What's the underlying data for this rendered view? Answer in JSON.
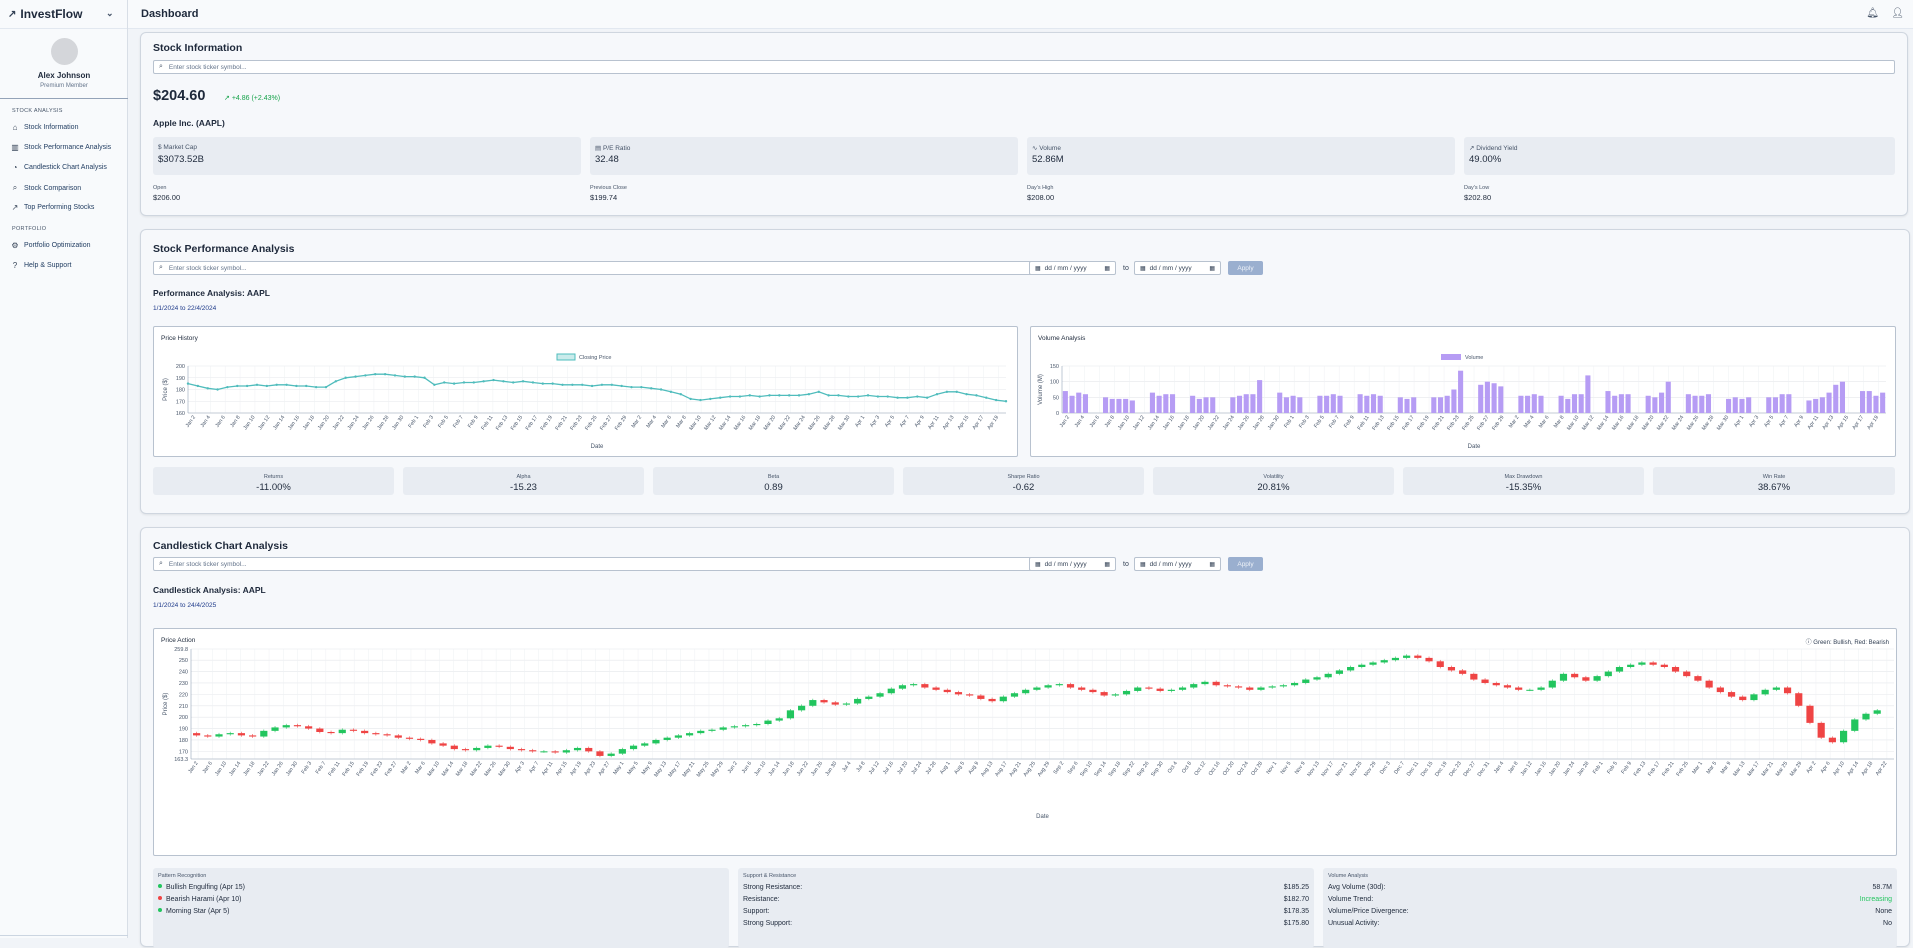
{
  "app": {
    "name": "InvestFlow",
    "page_title": "Dashboard"
  },
  "user": {
    "name": "Alex Johnson",
    "role": "Premium Member"
  },
  "nav": {
    "section_stock": "STOCK ANALYSIS",
    "section_portfolio": "PORTFOLIO",
    "items": [
      {
        "label": "Stock Information",
        "icon": "home-icon"
      },
      {
        "label": "Stock Performance Analysis",
        "icon": "bar-chart-icon"
      },
      {
        "label": "Candlestick Chart Analysis",
        "icon": "pie-chart-icon"
      },
      {
        "label": "Stock Comparison",
        "icon": "search-icon"
      },
      {
        "label": "Top Performing Stocks",
        "icon": "trending-up-icon"
      },
      {
        "label": "Portfolio Optimization",
        "icon": "gear-icon"
      },
      {
        "label": "Help & Support",
        "icon": "help-icon"
      }
    ]
  },
  "stock_info": {
    "title": "Stock Information",
    "search_placeholder": "Enter stock ticker symbol...",
    "price": "$204.60",
    "change": "+4.86 (+2.43%)",
    "company": "Apple Inc. (AAPL)",
    "metrics": [
      {
        "label": "Market Cap",
        "value": "$3073.52B",
        "icon": "dollar-icon"
      },
      {
        "label": "P/E Ratio",
        "value": "32.48",
        "icon": "calculator-icon"
      },
      {
        "label": "Volume",
        "value": "52.86M",
        "icon": "activity-icon"
      },
      {
        "label": "Dividend Yield",
        "value": "49.00%",
        "icon": "trending-up-icon"
      }
    ],
    "details": [
      {
        "label": "Open",
        "value": "$206.00"
      },
      {
        "label": "Previous Close",
        "value": "$199.74"
      },
      {
        "label": "Day's High",
        "value": "$208.00"
      },
      {
        "label": "Day's Low",
        "value": "$202.80"
      }
    ]
  },
  "performance": {
    "title": "Stock Performance Analysis",
    "search_placeholder": "Enter stock ticker symbol...",
    "date_placeholder": "dd / mm / yyyy",
    "to": "to",
    "apply": "Apply",
    "subtitle": "Performance Analysis: AAPL",
    "range": "1/1/2024 to 22/4/2024",
    "price_chart_title": "Price History",
    "volume_chart_title": "Volume Analysis",
    "stats": [
      {
        "label": "Returns",
        "value": "-11.00%"
      },
      {
        "label": "Alpha",
        "value": "-15.23"
      },
      {
        "label": "Beta",
        "value": "0.89"
      },
      {
        "label": "Sharpe Ratio",
        "value": "-0.62"
      },
      {
        "label": "Volatility",
        "value": "20.81%"
      },
      {
        "label": "Max Drawdown",
        "value": "-15.35%"
      },
      {
        "label": "Win Rate",
        "value": "38.67%"
      }
    ]
  },
  "candlestick": {
    "title": "Candlestick Chart Analysis",
    "search_placeholder": "Enter stock ticker symbol...",
    "date_placeholder": "dd / mm / yyyy",
    "to": "to",
    "apply": "Apply",
    "subtitle": "Candlestick Analysis: AAPL",
    "range": "1/1/2024 to 24/4/2025",
    "chart_title": "Price Action",
    "legend_note": "Green: Bullish, Red: Bearish",
    "patterns_header": "Pattern Recognition",
    "patterns": [
      {
        "label": "Bullish Engulfing (Apr 15)",
        "color": "#22c55e"
      },
      {
        "label": "Bearish Harami (Apr 10)",
        "color": "#ef4444"
      },
      {
        "label": "Morning Star (Apr 5)",
        "color": "#22c55e"
      }
    ],
    "sr_header": "Support & Resistance",
    "sr": [
      {
        "label": "Strong Resistance:",
        "value": "$185.25"
      },
      {
        "label": "Resistance:",
        "value": "$182.70"
      },
      {
        "label": "Support:",
        "value": "$178.35"
      },
      {
        "label": "Strong Support:",
        "value": "$175.80"
      }
    ],
    "vol_header": "Volume Analysis",
    "vol": [
      {
        "label": "Avg Volume (30d):",
        "value": "58.7M"
      },
      {
        "label": "Volume Trend:",
        "value": "Increasing",
        "color": "#22c55e"
      },
      {
        "label": "Volume/Price Divergence:",
        "value": "None"
      },
      {
        "label": "Unusual Activity:",
        "value": "No"
      }
    ]
  },
  "chart_data": [
    {
      "type": "line",
      "title": "Price History",
      "series_name": "Closing Price",
      "xlabel": "Date",
      "ylabel": "Price ($)",
      "ylim": [
        160,
        200
      ],
      "yticks": [
        160,
        170,
        180,
        190,
        200
      ],
      "x_ticks": [
        "Jan 2",
        "Jan 4",
        "Jan 6",
        "Jan 8",
        "Jan 10",
        "Jan 12",
        "Jan 14",
        "Jan 16",
        "Jan 18",
        "Jan 20",
        "Jan 22",
        "Jan 24",
        "Jan 26",
        "Jan 28",
        "Jan 30",
        "Feb 1",
        "Feb 3",
        "Feb 5",
        "Feb 7",
        "Feb 9",
        "Feb 11",
        "Feb 13",
        "Feb 15",
        "Feb 17",
        "Feb 19",
        "Feb 21",
        "Feb 23",
        "Feb 25",
        "Feb 27",
        "Feb 29",
        "Mar 2",
        "Mar 4",
        "Mar 6",
        "Mar 8",
        "Mar 10",
        "Mar 12",
        "Mar 14",
        "Mar 16",
        "Mar 18",
        "Mar 20",
        "Mar 22",
        "Mar 24",
        "Mar 26",
        "Mar 28",
        "Mar 30",
        "Apr 1",
        "Apr 3",
        "Apr 5",
        "Apr 7",
        "Apr 9",
        "Apr 11",
        "Apr 13",
        "Apr 15",
        "Apr 17",
        "Apr 19"
      ],
      "values": [
        185,
        183,
        181,
        180,
        182,
        183,
        183,
        184,
        183,
        184,
        184,
        183,
        183,
        182,
        182,
        187,
        190,
        191,
        192,
        193,
        193,
        192,
        191,
        191,
        190,
        184,
        186,
        185,
        186,
        186,
        187,
        188,
        187,
        186,
        187,
        186,
        185,
        185,
        184,
        184,
        184,
        183,
        184,
        184,
        183,
        182,
        182,
        181,
        180,
        178,
        176,
        172,
        171,
        172,
        173,
        174,
        174,
        175,
        174,
        175,
        175,
        175,
        175,
        176,
        178,
        175,
        175,
        174,
        174,
        175,
        174,
        174,
        173,
        173,
        174,
        173,
        176,
        178,
        178,
        176,
        175,
        173,
        171,
        170
      ]
    },
    {
      "type": "bar",
      "title": "Volume Analysis",
      "series_name": "Volume",
      "xlabel": "Date",
      "ylabel": "Volume (M)",
      "ylim": [
        0,
        150
      ],
      "yticks": [
        0,
        50,
        100,
        150
      ],
      "x_ticks": [
        "Jan 2",
        "Jan 4",
        "Jan 6",
        "Jan 8",
        "Jan 10",
        "Jan 12",
        "Jan 14",
        "Jan 16",
        "Jan 18",
        "Jan 20",
        "Jan 22",
        "Jan 24",
        "Jan 26",
        "Jan 28",
        "Jan 30",
        "Feb 1",
        "Feb 3",
        "Feb 5",
        "Feb 7",
        "Feb 9",
        "Feb 11",
        "Feb 13",
        "Feb 15",
        "Feb 17",
        "Feb 19",
        "Feb 21",
        "Feb 23",
        "Feb 25",
        "Feb 27",
        "Feb 29",
        "Mar 2",
        "Mar 4",
        "Mar 6",
        "Mar 8",
        "Mar 10",
        "Mar 12",
        "Mar 14",
        "Mar 16",
        "Mar 18",
        "Mar 20",
        "Mar 22",
        "Mar 24",
        "Mar 26",
        "Mar 28",
        "Mar 30",
        "Apr 1",
        "Apr 3",
        "Apr 5",
        "Apr 7",
        "Apr 9",
        "Apr 11",
        "Apr 13",
        "Apr 15",
        "Apr 17",
        "Apr 19"
      ],
      "values": [
        70,
        55,
        65,
        60,
        0,
        0,
        50,
        45,
        45,
        45,
        40,
        0,
        0,
        65,
        55,
        60,
        60,
        0,
        0,
        55,
        45,
        50,
        50,
        0,
        0,
        50,
        55,
        60,
        60,
        105,
        0,
        0,
        65,
        50,
        55,
        50,
        0,
        0,
        55,
        55,
        60,
        55,
        0,
        0,
        60,
        55,
        60,
        55,
        0,
        0,
        50,
        45,
        50,
        0,
        0,
        50,
        50,
        55,
        75,
        135,
        0,
        0,
        90,
        100,
        95,
        85,
        0,
        0,
        55,
        55,
        60,
        55,
        0,
        0,
        55,
        45,
        60,
        60,
        120,
        0,
        0,
        70,
        55,
        60,
        60,
        0,
        0,
        55,
        50,
        65,
        100,
        0,
        0,
        60,
        55,
        55,
        60,
        0,
        0,
        45,
        50,
        45,
        50,
        0,
        0,
        50,
        50,
        60,
        60,
        0,
        0,
        40,
        45,
        50,
        65,
        90,
        100,
        0,
        0,
        70,
        70,
        55,
        65
      ]
    },
    {
      "type": "candlestick",
      "title": "Price Action",
      "xlabel": "Date",
      "ylabel": "Price ($)",
      "ylim": [
        163.3,
        259.8
      ],
      "yticks": [
        163.3,
        170,
        180,
        190,
        200,
        210,
        220,
        230,
        240,
        250,
        259.8
      ],
      "x_ticks": [
        "Jan 2",
        "Jan 6",
        "Jan 10",
        "Jan 14",
        "Jan 18",
        "Jan 22",
        "Jan 26",
        "Jan 30",
        "Feb 3",
        "Feb 7",
        "Feb 11",
        "Feb 15",
        "Feb 19",
        "Feb 23",
        "Feb 27",
        "Mar 2",
        "Mar 6",
        "Mar 10",
        "Mar 14",
        "Mar 18",
        "Mar 22",
        "Mar 26",
        "Mar 30",
        "Apr 3",
        "Apr 7",
        "Apr 11",
        "Apr 15",
        "Apr 19",
        "Apr 23",
        "Apr 27",
        "May 1",
        "May 5",
        "May 9",
        "May 13",
        "May 17",
        "May 21",
        "May 25",
        "May 29",
        "Jun 2",
        "Jun 6",
        "Jun 10",
        "Jun 14",
        "Jun 18",
        "Jun 22",
        "Jun 26",
        "Jun 30",
        "Jul 4",
        "Jul 8",
        "Jul 12",
        "Jul 16",
        "Jul 20",
        "Jul 24",
        "Jul 28",
        "Aug 1",
        "Aug 5",
        "Aug 9",
        "Aug 13",
        "Aug 17",
        "Aug 21",
        "Aug 25",
        "Aug 29",
        "Sep 2",
        "Sep 6",
        "Sep 10",
        "Sep 14",
        "Sep 18",
        "Sep 22",
        "Sep 26",
        "Sep 30",
        "Oct 4",
        "Oct 8",
        "Oct 12",
        "Oct 16",
        "Oct 20",
        "Oct 24",
        "Oct 28",
        "Nov 1",
        "Nov 5",
        "Nov 9",
        "Nov 13",
        "Nov 17",
        "Nov 21",
        "Nov 25",
        "Nov 29",
        "Dec 3",
        "Dec 7",
        "Dec 11",
        "Dec 15",
        "Dec 19",
        "Dec 23",
        "Dec 27",
        "Dec 31",
        "Jan 4",
        "Jan 8",
        "Jan 12",
        "Jan 16",
        "Jan 20",
        "Jan 24",
        "Jan 28",
        "Feb 1",
        "Feb 5",
        "Feb 9",
        "Feb 13",
        "Feb 17",
        "Feb 21",
        "Feb 25",
        "Mar 1",
        "Mar 5",
        "Mar 9",
        "Mar 13",
        "Mar 17",
        "Mar 21",
        "Mar 25",
        "Mar 29",
        "Apr 2",
        "Apr 6",
        "Apr 10",
        "Apr 14",
        "Apr 18",
        "Apr 22"
      ],
      "closes": [
        186,
        184,
        183,
        185,
        186,
        184,
        183,
        188,
        191,
        193,
        192,
        190,
        187,
        186,
        189,
        188,
        186,
        185,
        184,
        182,
        181,
        180,
        177,
        175,
        172,
        171,
        173,
        175,
        174,
        172,
        171,
        170,
        170,
        169,
        171,
        173,
        170,
        166,
        168,
        172,
        175,
        177,
        180,
        182,
        184,
        186,
        188,
        189,
        191,
        192,
        193,
        194,
        197,
        199,
        206,
        210,
        215,
        213,
        211,
        212,
        216,
        218,
        221,
        225,
        228,
        229,
        226,
        224,
        222,
        220,
        219,
        216,
        214,
        218,
        221,
        224,
        226,
        228,
        229,
        226,
        224,
        222,
        219,
        220,
        223,
        226,
        225,
        223,
        224,
        226,
        229,
        231,
        228,
        227,
        226,
        224,
        226,
        227,
        228,
        230,
        233,
        235,
        238,
        241,
        244,
        246,
        248,
        250,
        252,
        254,
        252,
        249,
        244,
        241,
        238,
        233,
        230,
        228,
        226,
        224,
        224,
        226,
        232,
        238,
        235,
        232,
        236,
        240,
        244,
        246,
        248,
        246,
        244,
        240,
        236,
        232,
        226,
        222,
        218,
        215,
        220,
        224,
        226,
        221,
        210,
        195,
        182,
        178,
        188,
        198,
        203,
        206
      ]
    }
  ]
}
